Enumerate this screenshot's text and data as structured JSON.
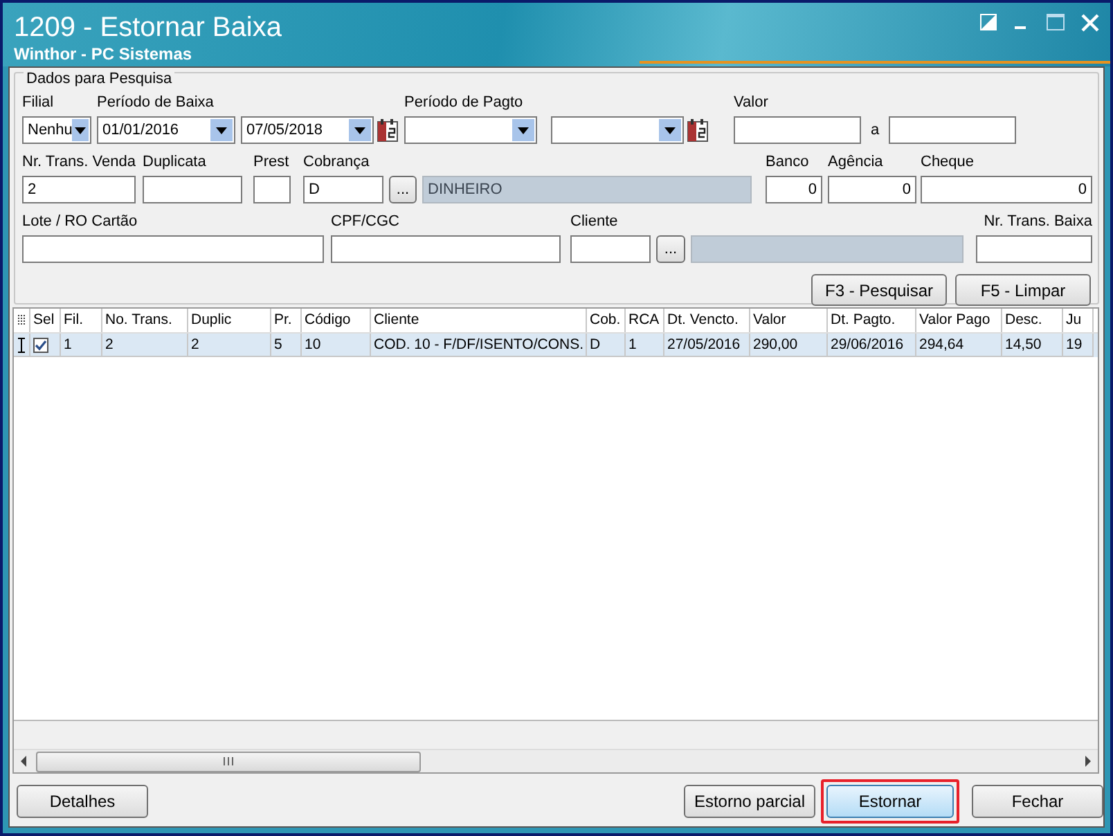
{
  "window": {
    "title": "1209 - Estornar Baixa",
    "subtitle": "Winthor - PC Sistemas"
  },
  "search_panel": {
    "title": "Dados para Pesquisa",
    "rows": [
      {
        "groups": [
          {
            "label": "Filial",
            "controls": [
              {
                "kind": "select",
                "value": "Nenhu"
              }
            ]
          },
          {
            "label": "Período de Baixa",
            "controls": [
              {
                "kind": "date",
                "value": "01/01/2016"
              },
              {
                "kind": "date-calendar",
                "value": "07/05/2018"
              }
            ]
          },
          {
            "label": "Período de Pagto",
            "controls": [
              {
                "kind": "date"
              },
              {
                "kind": "date-calendar"
              }
            ]
          },
          {
            "label": "Valor",
            "controls": [
              {
                "kind": "text"
              },
              {
                "kind": "separator",
                "text": "a"
              },
              {
                "kind": "text"
              }
            ]
          }
        ]
      },
      {
        "groups": [
          {
            "label": "Nr. Trans. Venda",
            "controls": [
              {
                "kind": "text",
                "value": "2"
              }
            ]
          },
          {
            "label": "Duplicata",
            "controls": [
              {
                "kind": "text"
              }
            ]
          },
          {
            "label": "Prest",
            "controls": [
              {
                "kind": "text"
              }
            ]
          },
          {
            "label": "Cobrança",
            "controls": [
              {
                "kind": "text",
                "value": "D"
              },
              {
                "kind": "lookup",
                "text": "..."
              },
              {
                "kind": "readonly",
                "value": "DINHEIRO"
              }
            ]
          },
          {
            "label": "Banco",
            "controls": [
              {
                "kind": "number",
                "value": "0"
              }
            ]
          },
          {
            "label": "Agência",
            "controls": [
              {
                "kind": "number",
                "value": "0"
              }
            ]
          },
          {
            "label": "Cheque",
            "controls": [
              {
                "kind": "number",
                "value": "0"
              }
            ]
          }
        ]
      },
      {
        "groups": [
          {
            "label": "Lote / RO Cartão",
            "controls": [
              {
                "kind": "text"
              }
            ]
          },
          {
            "label": "CPF/CGC",
            "controls": [
              {
                "kind": "text"
              }
            ]
          },
          {
            "label": "Cliente",
            "controls": [
              {
                "kind": "text"
              },
              {
                "kind": "lookup",
                "text": "..."
              },
              {
                "kind": "readonly"
              }
            ]
          },
          {
            "label": "Nr. Trans. Baixa",
            "controls": [
              {
                "kind": "text"
              }
            ]
          }
        ]
      }
    ],
    "buttons": [
      "F3 - Pesquisar",
      "F5 - Limpar"
    ]
  },
  "table": {
    "columns": [
      "Sel",
      "Fil.",
      "No. Trans.",
      "Duplic",
      "Pr.",
      "Código",
      "Cliente",
      "Cob.",
      "RCA",
      "Dt. Vencto.",
      "Valor",
      "Dt. Pagto.",
      "Valor Pago",
      "Desc.",
      "Ju"
    ],
    "rows": [
      {
        "selected": true,
        "checked": true,
        "cells": [
          "",
          "1",
          "2",
          "2",
          "5",
          "10",
          "COD. 10 - F/DF/ISENTO/CONS.",
          "D",
          "1",
          "27/05/2016",
          "290,00",
          "29/06/2016",
          "294,64",
          "14,50",
          "19"
        ]
      }
    ]
  },
  "buttons": [
    {
      "label": "Detalhes",
      "highlighted": false
    },
    {
      "label": "Estorno parcial",
      "highlighted": false
    },
    {
      "label": "Estornar",
      "highlighted": true
    },
    {
      "label": "Fechar",
      "highlighted": false
    }
  ]
}
